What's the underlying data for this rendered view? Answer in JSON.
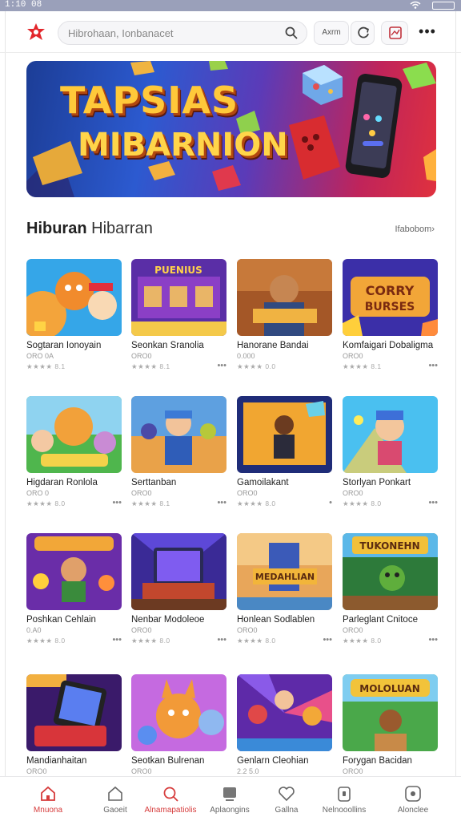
{
  "statusbar": {
    "time": "1:10 08"
  },
  "topbar": {
    "search_placeholder": "Hibrohaan, Ionbanacet",
    "lang_label": "Axrm",
    "icons": [
      "logo-icon",
      "search-icon",
      "refresh-icon",
      "gift-icon",
      "more-icon"
    ]
  },
  "banner": {
    "line1": "TAPSIAS",
    "line2": "MIBARNION"
  },
  "section": {
    "title_bold": "Hiburan",
    "title_light": "Hibarran",
    "see_all": "Ifabobom"
  },
  "games": [
    {
      "name": "Sogtaran Ionoyain",
      "sub": "ORO 0A",
      "rating": "★★★★ 8.1"
    },
    {
      "name": "Seonkan Sranolia",
      "sub": "ORO0",
      "rating": "★★★★ 8.1"
    },
    {
      "name": "Hanorane Bandai",
      "sub": "0.000",
      "rating": "★★★★ 0.0"
    },
    {
      "name": "Komfaigari Dobaligma",
      "sub": "ORO0",
      "rating": "★★★★ 8.1"
    },
    {
      "name": "Higdaran Ronlola",
      "sub": "ORO 0",
      "rating": "★★★★ 8.0"
    },
    {
      "name": "Serttanban",
      "sub": "ORO0",
      "rating": "★★★★ 8.1"
    },
    {
      "name": "Gamoilakant",
      "sub": "ORO0",
      "rating": "★★★★ 8.0"
    },
    {
      "name": "Storlyan Ponkart",
      "sub": "ORO0",
      "rating": "★★★★ 8.0"
    },
    {
      "name": "Poshkan Cehlain",
      "sub": "0.A0",
      "rating": "★★★★ 8.0"
    },
    {
      "name": "Nenbar Modoleoe",
      "sub": "ORO0",
      "rating": "★★★★ 8.0"
    },
    {
      "name": "Honlean Sodlablen",
      "sub": "ORO0",
      "rating": "★★★★ 8.0"
    },
    {
      "name": "Parleglant Cnitoce",
      "sub": "ORO0",
      "rating": "★★★★ 8.0"
    },
    {
      "name": "Mandianhaitan",
      "sub": "ORO0",
      "rating": ""
    },
    {
      "name": "Seotkan Bulrenan",
      "sub": "ORO0",
      "rating": ""
    },
    {
      "name": "Genlarn Cleohian",
      "sub": "2.2 5.0",
      "rating": ""
    },
    {
      "name": "Forygan Bacidan",
      "sub": "ORO0",
      "rating": ""
    }
  ],
  "bottomnav": [
    {
      "label": "Mnuona",
      "icon": "home-icon",
      "active": true
    },
    {
      "label": "Gaoeit",
      "icon": "house-icon",
      "active": false
    },
    {
      "label": "Alnamapatiolis",
      "icon": "search-icon",
      "active": true
    },
    {
      "label": "Aplaongins",
      "icon": "tv-icon",
      "active": false
    },
    {
      "label": "Gallna",
      "icon": "heart-icon",
      "active": false
    },
    {
      "label": "Nelnooollins",
      "icon": "tablet-icon",
      "active": false
    },
    {
      "label": "Alonclee",
      "icon": "profile-icon",
      "active": false
    }
  ],
  "colors": {
    "accent": "#d63b3b",
    "banner_text": "#ffc93a"
  }
}
